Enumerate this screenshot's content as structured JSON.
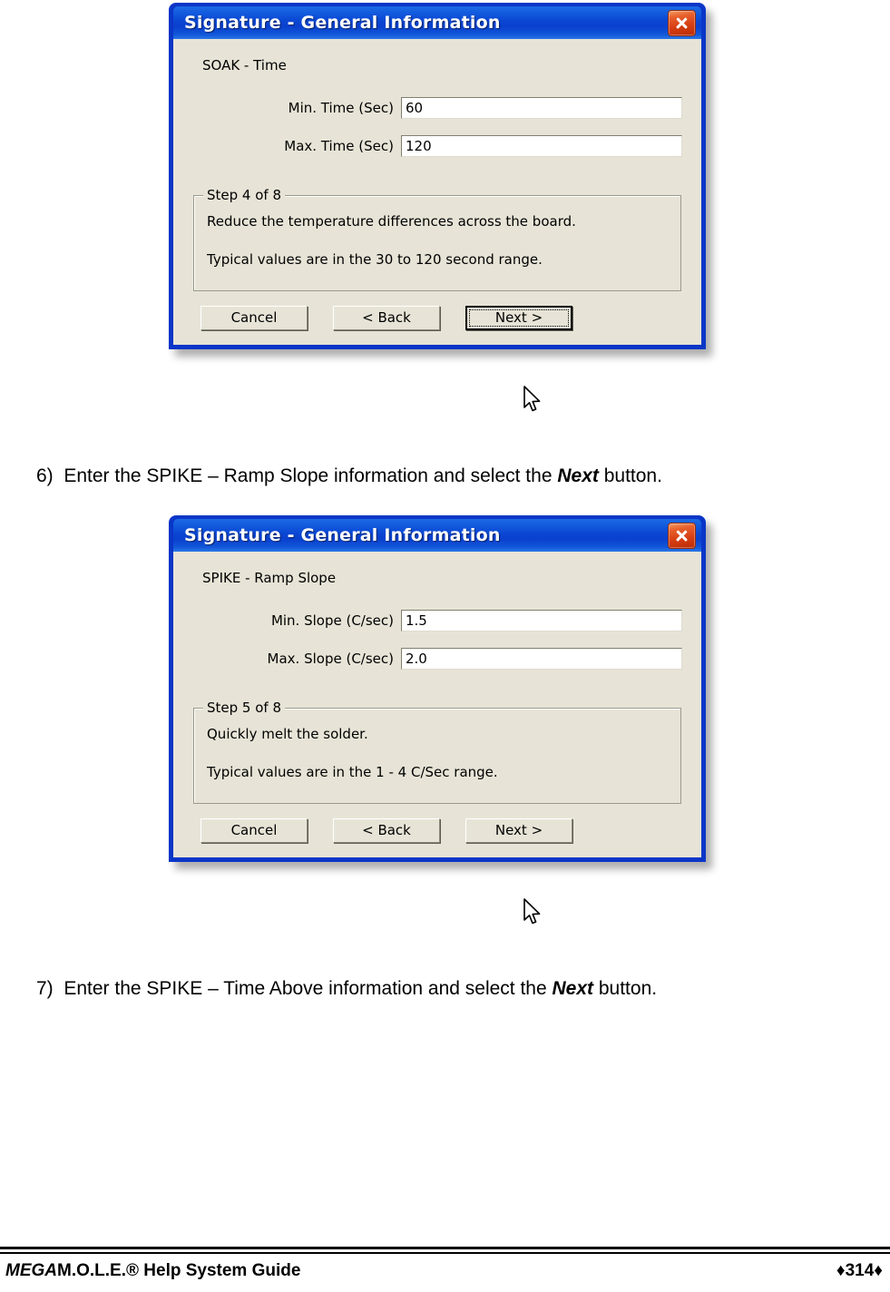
{
  "page": {
    "footer_left_italic": "MEGA",
    "footer_left_rest": "M.O.L.E.® Help System Guide",
    "footer_page": "♦314♦"
  },
  "steps": [
    {
      "number": "6)",
      "text_before": "Enter the SPIKE – Ramp Slope information and select the ",
      "emphasis": "Next",
      "text_after": " button."
    },
    {
      "number": "7)",
      "text_before": "Enter the SPIKE – Time Above information and select the ",
      "emphasis": "Next",
      "text_after": " button."
    }
  ],
  "dialogs": [
    {
      "title": "Signature  -  General Information",
      "close_icon": "close-icon",
      "section_title": "SOAK - Time",
      "fields": [
        {
          "label": "Min. Time (Sec)",
          "value": "60"
        },
        {
          "label": "Max. Time (Sec)",
          "value": "120"
        }
      ],
      "group": {
        "legend": "Step 4 of 8",
        "line1": "Reduce the temperature differences across the board.",
        "line2": "Typical values are in the 30 to 120 second range."
      },
      "buttons": [
        {
          "label": "Cancel",
          "default": false
        },
        {
          "label": "< Back",
          "default": false
        },
        {
          "label": "Next >",
          "default": true
        }
      ]
    },
    {
      "title": "Signature  -  General Information",
      "close_icon": "close-icon",
      "section_title": "SPIKE - Ramp Slope",
      "fields": [
        {
          "label": "Min. Slope (C/sec)",
          "value": "1.5"
        },
        {
          "label": "Max. Slope (C/sec)",
          "value": "2.0"
        }
      ],
      "group": {
        "legend": "Step 5 of 8",
        "line1": "Quickly melt the solder.",
        "line2": "Typical values are in the 1 - 4 C/Sec range."
      },
      "buttons": [
        {
          "label": "Cancel",
          "default": false
        },
        {
          "label": "< Back",
          "default": false
        },
        {
          "label": "Next >",
          "default": false
        }
      ]
    }
  ],
  "colors": {
    "title_bar_blue": "#0b48d4",
    "dialog_face": "#e7e4d7",
    "close_red": "#d63d12",
    "frame_blue": "#0a36c8"
  }
}
